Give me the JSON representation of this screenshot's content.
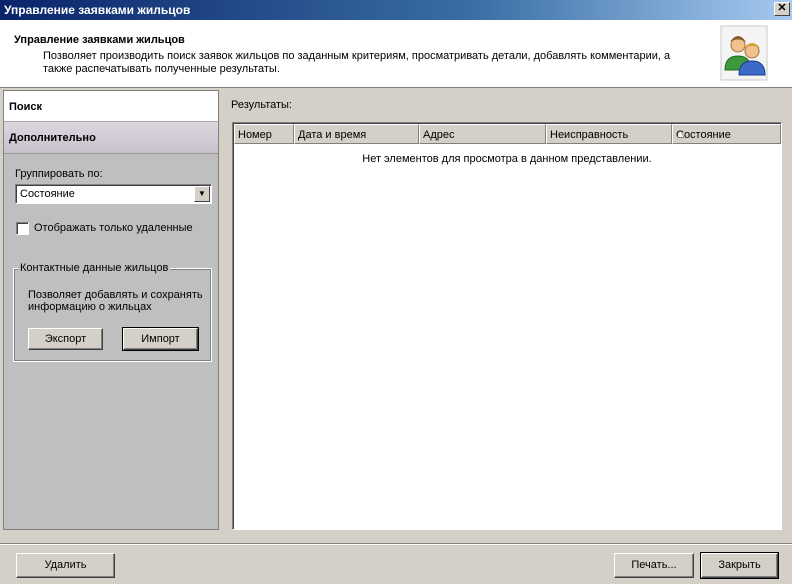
{
  "window": {
    "title": "Управление заявками жильцов",
    "close_symbol": "✕"
  },
  "header": {
    "title": "Управление заявками жильцов",
    "description": "Позволяет производить поиск заявок жильцов по заданным критериям, просматривать детали, добавлять комментарии, а также распечатывать полученные результаты.",
    "icon": "users-icon"
  },
  "sidebar": {
    "nav": [
      {
        "label": "Поиск"
      },
      {
        "label": "Дополнительно"
      }
    ],
    "group_by_label": "Группировать по:",
    "group_by_value": "Состояние",
    "show_deleted_label": "Отображать только удаленные",
    "show_deleted_checked": false,
    "contacts_group": {
      "legend": "Контактные данные жильцов",
      "description": "Позволяет добавлять и сохранять информацию о жильцах",
      "export_label": "Экспорт",
      "import_label": "Импорт"
    }
  },
  "results": {
    "label": "Результаты:",
    "columns": [
      "Номер",
      "Дата и время",
      "Адрес",
      "Неисправность",
      "Состояние"
    ],
    "sorted_column": "Состояние",
    "empty_message": "Нет элементов для просмотра в данном представлении."
  },
  "footer": {
    "delete_label": "Удалить",
    "print_label": "Печать...",
    "close_label": "Закрыть"
  },
  "colors": {
    "title_bar": "#0a246a",
    "panel_bg": "#d4d0c8",
    "sidebar_bg": "#bfbfbf"
  }
}
